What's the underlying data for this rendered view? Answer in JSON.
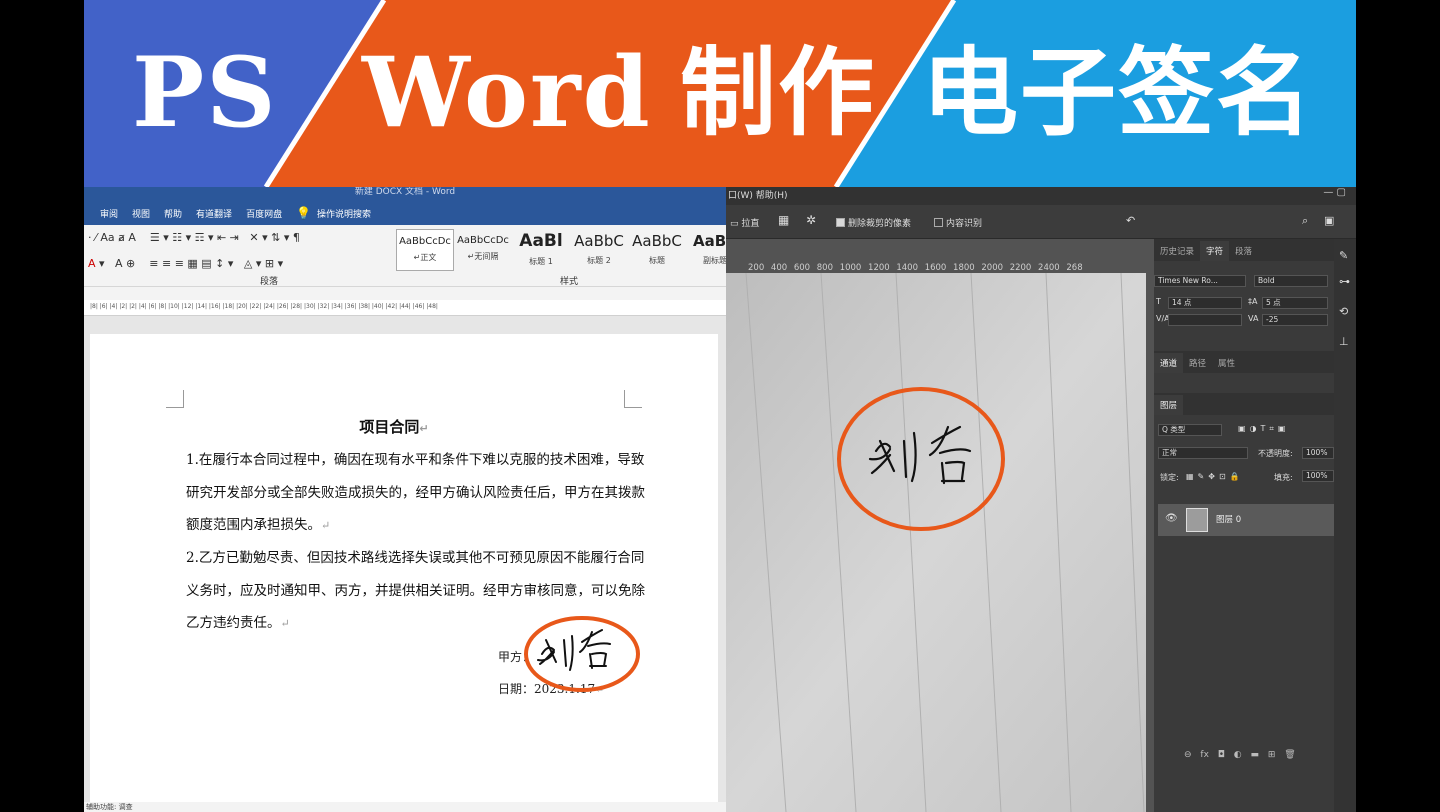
{
  "banner": {
    "ps": "PS",
    "word": "Word",
    "make": "制作",
    "sign": "电子签名",
    "colors": {
      "left": "#4262c8",
      "middle": "#e8581a",
      "right": "#1b9ee0"
    }
  },
  "word": {
    "title": "新建 DOCX 文档 - Word",
    "menu": [
      "审阅",
      "视图",
      "帮助",
      "有道翻译",
      "百度网盘",
      "操作说明搜索"
    ],
    "styles": [
      {
        "sample": "AaBbCcDc",
        "label": "↵正文"
      },
      {
        "sample": "AaBbCcDc",
        "label": "↵无间隔"
      },
      {
        "sample": "AaBl",
        "label": "标题 1"
      },
      {
        "sample": "AaBbC",
        "label": "标题 2"
      },
      {
        "sample": "AaBbC",
        "label": "标题"
      },
      {
        "sample": "AaBb",
        "label": "副标题"
      }
    ],
    "group_paragraph": "段落",
    "group_styles": "样式",
    "ruler": "|8| |6| |4| |2|     |2| |4| |6| |8| |10| |12| |14| |16| |18| |20| |22| |24| |26| |28| |30| |32| |34| |36| |38| |40| |42| |44| |46| |48|",
    "doc": {
      "title": "项目合同",
      "p1": "1.在履行本合同过程中，确因在现有水平和条件下难以克服的技术困难，导致研究开发部分或全部失败造成损失的，经甲方确认风险责任后，甲方在其拨款额度范围内承担损失。",
      "p2": "2.乙方已勤勉尽责、但因技术路线选择失误或其他不可预见原因不能履行合同义务时，应及时通知甲、丙方，并提供相关证明。经甲方审核同意，可以免除乙方违约责任。",
      "party": "甲方：",
      "date_label": "日期：",
      "date_value": "2023.1.17",
      "signature": "刘备",
      "para_mark": "↵"
    },
    "status": "辅助功能: 调查"
  },
  "ps": {
    "menu": "口(W)  帮助(H)",
    "options": {
      "straighten": "拉直",
      "delete_crop": "删除裁剪的像素",
      "content_aware": "内容识别"
    },
    "ruler_numbers": "200 400 600 800 1000 1200 1400 1600 1800 2000 2200 2400 268",
    "char_tabs": [
      "历史记录",
      "字符",
      "段落"
    ],
    "font": "Times New Ro...",
    "font_style": "Bold",
    "size": "14 点",
    "leading": "5 点",
    "tracking": "-25",
    "layer_tabs": [
      "通道",
      "路径",
      "属性"
    ],
    "layers_title": "图层",
    "filter": "Q 类型",
    "blend": "正常",
    "opacity_label": "不透明度:",
    "opacity": "100%",
    "lock_label": "锁定:",
    "fill_label": "填充:",
    "fill": "100%",
    "layer_name": "图层 0",
    "signature": "刘备",
    "accent_circle": "#e8581a"
  }
}
